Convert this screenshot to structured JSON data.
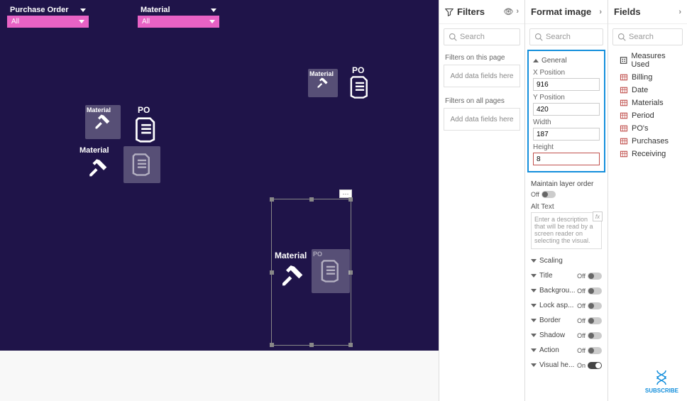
{
  "canvas": {
    "slicer_po": {
      "label": "Purchase Order",
      "value": "All"
    },
    "slicer_mat": {
      "label": "Material",
      "value": "All"
    },
    "tile_material": "Material",
    "tile_po": "PO",
    "tile_material2": "Material",
    "tile_po2": "PO",
    "sel_material": "Material",
    "sel_po": "PO"
  },
  "filters": {
    "title": "Filters",
    "search_placeholder": "Search",
    "section_page": "Filters on this page",
    "drop_text": "Add data fields here",
    "section_all": "Filters on all pages"
  },
  "format": {
    "title": "Format image",
    "search_placeholder": "Search",
    "general": {
      "title": "General",
      "x_label": "X Position",
      "x_value": "916",
      "y_label": "Y Position",
      "y_value": "420",
      "w_label": "Width",
      "w_value": "187",
      "h_label": "Height",
      "h_value": "8"
    },
    "maintain_label": "Maintain layer order",
    "maintain_state": "Off",
    "alt_label": "Alt Text",
    "alt_placeholder": "Enter a description that will be read by a screen reader on selecting the visual.",
    "fx": "fx",
    "rows": [
      {
        "label": "Scaling",
        "toggle": null
      },
      {
        "label": "Title",
        "toggle": "Off"
      },
      {
        "label": "Backgrou...",
        "toggle": "Off"
      },
      {
        "label": "Lock asp...",
        "toggle": "Off"
      },
      {
        "label": "Border",
        "toggle": "Off"
      },
      {
        "label": "Shadow",
        "toggle": "Off"
      },
      {
        "label": "Action",
        "toggle": "Off"
      },
      {
        "label": "Visual he...",
        "toggle": "On"
      }
    ]
  },
  "fields": {
    "title": "Fields",
    "search_placeholder": "Search",
    "items": [
      {
        "name": "Measures Used",
        "kind": "meas"
      },
      {
        "name": "Billing",
        "kind": "table"
      },
      {
        "name": "Date",
        "kind": "table"
      },
      {
        "name": "Materials",
        "kind": "table"
      },
      {
        "name": "Period",
        "kind": "table"
      },
      {
        "name": "PO's",
        "kind": "table"
      },
      {
        "name": "Purchases",
        "kind": "table"
      },
      {
        "name": "Receiving",
        "kind": "table"
      }
    ]
  },
  "subscribe": "SUBSCRIBE"
}
